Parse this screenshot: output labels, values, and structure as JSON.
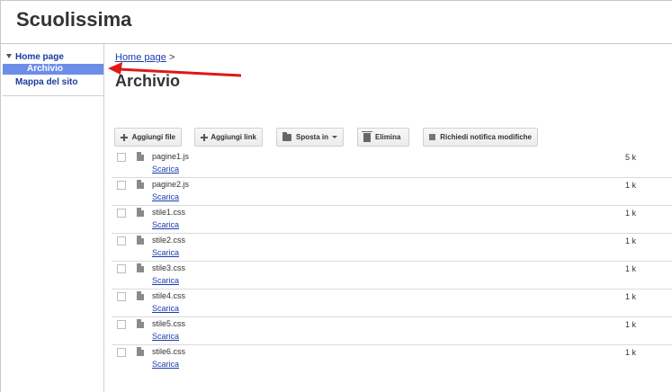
{
  "site": {
    "title": "Scuolissima"
  },
  "sidebar": {
    "items": [
      {
        "label": "Home page"
      },
      {
        "label": "Archivio"
      },
      {
        "label": "Mappa del sito"
      }
    ]
  },
  "breadcrumb": {
    "link": "Home page",
    "separator": ">"
  },
  "page": {
    "title": "Archivio"
  },
  "toolbar": {
    "add_file": "Aggiungi file",
    "add_link": "Aggiungi link",
    "move_to": "Sposta in",
    "delete": "Elimina",
    "notify": "Richiedi notifica modifiche"
  },
  "files": [
    {
      "name": "pagine1.js",
      "size": "5 k",
      "action": "Scarica"
    },
    {
      "name": "pagine2.js",
      "size": "1 k",
      "action": "Scarica"
    },
    {
      "name": "stile1.css",
      "size": "1 k",
      "action": "Scarica"
    },
    {
      "name": "stile2.css",
      "size": "1 k",
      "action": "Scarica"
    },
    {
      "name": "stile3.css",
      "size": "1 k",
      "action": "Scarica"
    },
    {
      "name": "stile4.css",
      "size": "1 k",
      "action": "Scarica"
    },
    {
      "name": "stile5.css",
      "size": "1 k",
      "action": "Scarica"
    },
    {
      "name": "stile6.css",
      "size": "1 k",
      "action": "Scarica"
    }
  ],
  "colors": {
    "annotation_arrow": "#e01818",
    "selected_nav": "#6d8ee8",
    "link": "#1a3cb0"
  }
}
